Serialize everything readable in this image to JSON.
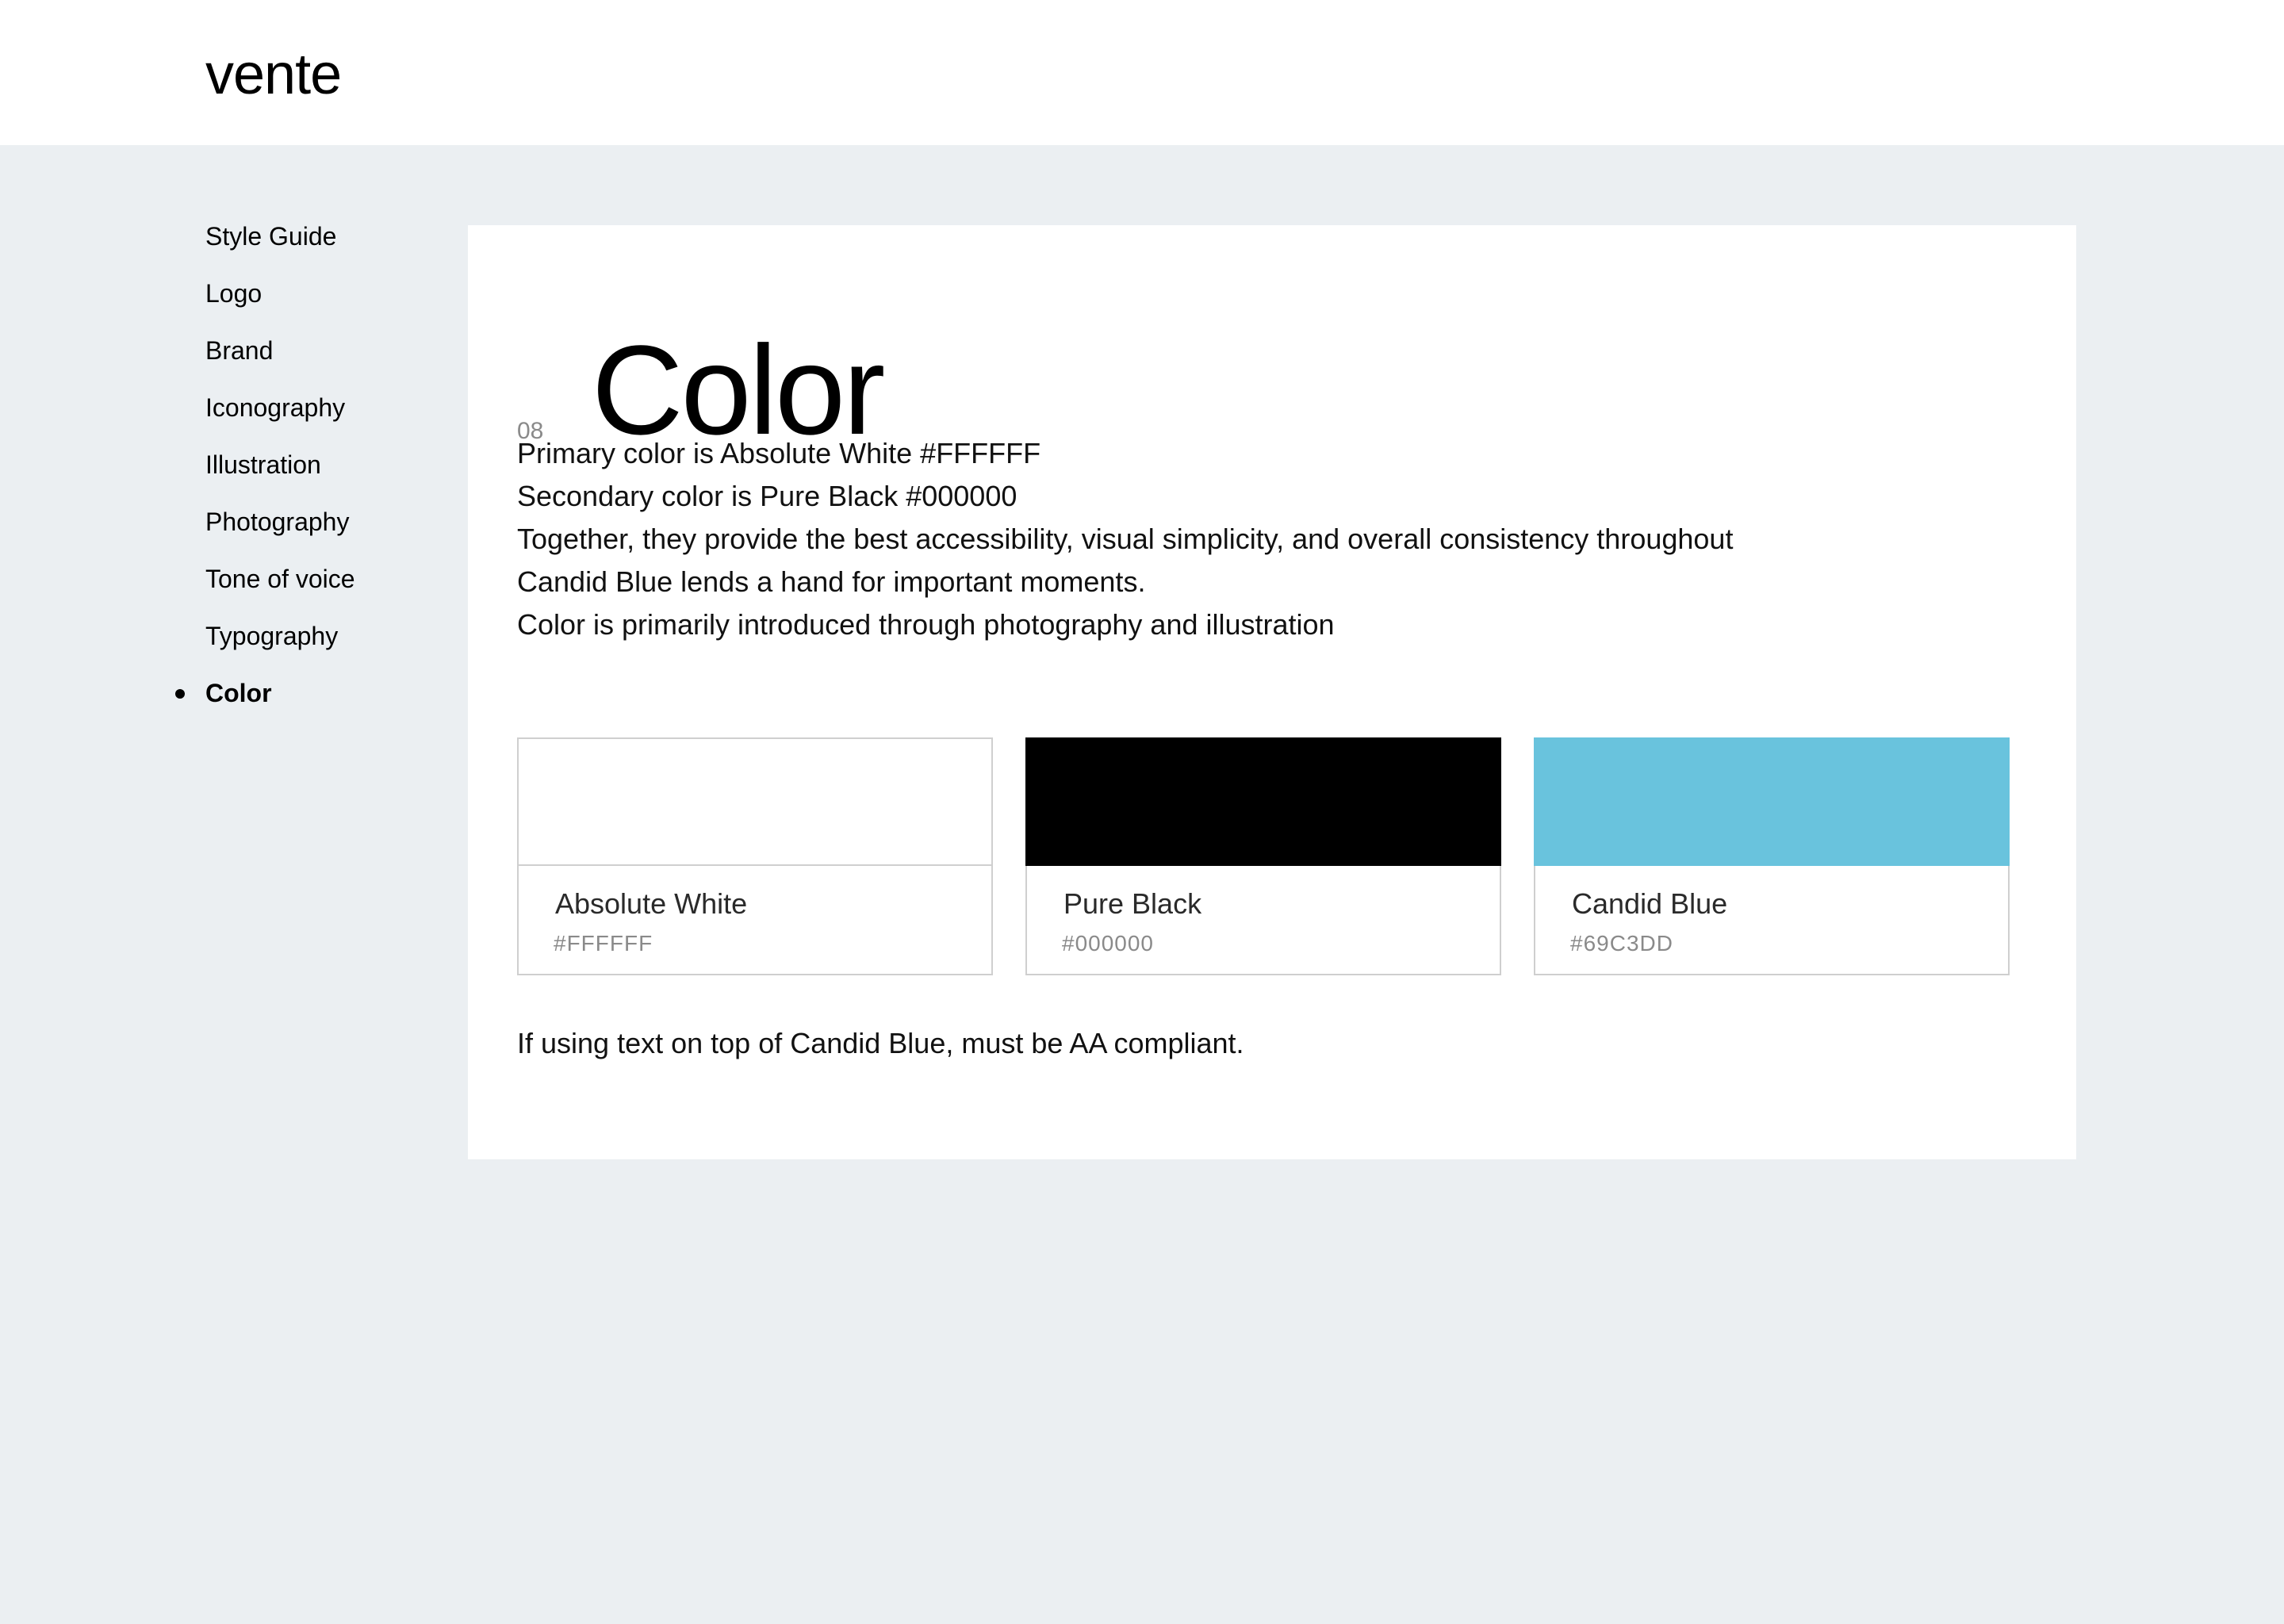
{
  "header": {
    "logo": "vente"
  },
  "sidebar": {
    "items": [
      {
        "label": "Style Guide",
        "active": false
      },
      {
        "label": "Logo",
        "active": false
      },
      {
        "label": "Brand",
        "active": false
      },
      {
        "label": "Iconography",
        "active": false
      },
      {
        "label": "Illustration",
        "active": false
      },
      {
        "label": "Photography",
        "active": false
      },
      {
        "label": "Tone of voice",
        "active": false
      },
      {
        "label": "Typography",
        "active": false
      },
      {
        "label": "Color",
        "active": true
      }
    ]
  },
  "main": {
    "section_number": "08",
    "title": "Color",
    "intro_lines": [
      "Primary color is Absolute White #FFFFFF",
      "Secondary color is Pure Black #000000",
      "Together, they provide the best accessibility, visual simplicity, and overall consistency throughout",
      "Candid Blue lends a hand for important moments.",
      "Color is primarily introduced through photography and illustration"
    ],
    "swatches": [
      {
        "name": "Absolute White",
        "hex": "#FFFFFF",
        "color": "#FFFFFF"
      },
      {
        "name": "Pure Black",
        "hex": "#000000",
        "color": "#000000"
      },
      {
        "name": "Candid Blue",
        "hex": "#69C3DD",
        "color": "#69C3DD"
      }
    ],
    "note": "If using text on top of Candid Blue, must be AA compliant."
  },
  "colors": {
    "page_background": "#EBEFF2",
    "card_background": "#FFFFFF",
    "accent": "#69C3DD"
  }
}
